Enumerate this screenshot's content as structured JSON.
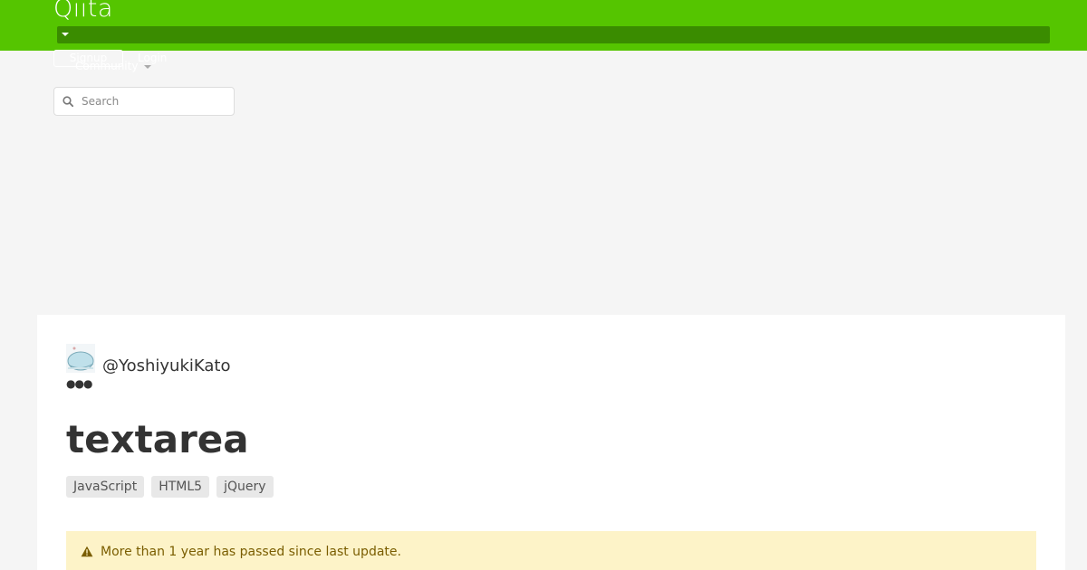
{
  "header": {
    "logo_text": "Qiita",
    "signup_label": "Signup",
    "login_label": "Login",
    "community_label": "Community",
    "brand_color": "#55c500"
  },
  "search": {
    "placeholder": "Search",
    "value": ""
  },
  "article": {
    "author": "@YoshiyukiKato",
    "title": "textarea",
    "tags": [
      "JavaScript",
      "HTML5",
      "jQuery"
    ],
    "notice": "More than 1 year has passed since last update."
  },
  "icons": {
    "logo": "qiita-logo",
    "menu_caret": "chevron-down-icon",
    "search": "search-icon",
    "avatar": "avatar-image",
    "more": "ellipsis-icon",
    "warning": "warning-icon"
  }
}
